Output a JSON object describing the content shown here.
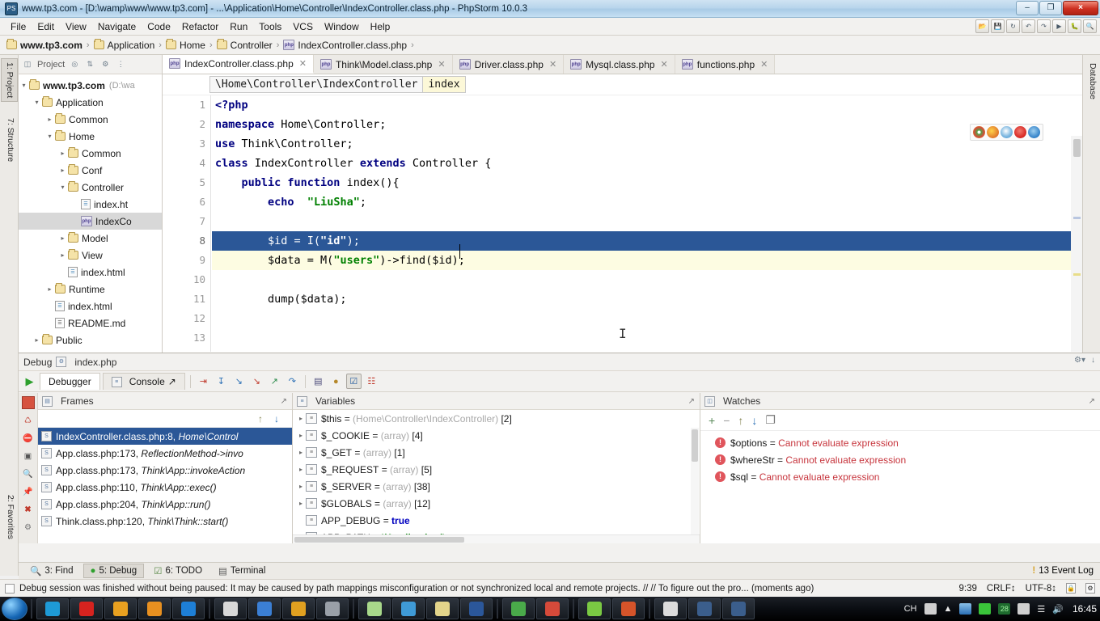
{
  "window": {
    "title": "www.tp3.com - [D:\\wamp\\www\\www.tp3.com] - ...\\Application\\Home\\Controller\\IndexController.class.php - PhpStorm 10.0.3",
    "minimize_label": "–",
    "maximize_label": "❐",
    "close_label": "×"
  },
  "menu": {
    "items": [
      "File",
      "Edit",
      "View",
      "Navigate",
      "Code",
      "Refactor",
      "Run",
      "Tools",
      "VCS",
      "Window",
      "Help"
    ]
  },
  "breadcrumb": {
    "items": [
      {
        "label": "www.tp3.com",
        "icon": "folder-icon"
      },
      {
        "label": "Application",
        "icon": "folder-icon"
      },
      {
        "label": "Home",
        "icon": "folder-icon"
      },
      {
        "label": "Controller",
        "icon": "folder-icon"
      },
      {
        "label": "IndexController.class.php",
        "icon": "php-file-icon"
      }
    ],
    "separator": "›"
  },
  "left_tool_strip": {
    "tabs": [
      {
        "label": "1: Project",
        "active": true
      },
      {
        "label": "7: Structure",
        "active": false
      },
      {
        "label": "2: Favorites",
        "active": false
      }
    ]
  },
  "right_tool_strip": {
    "tabs": [
      {
        "label": "Database"
      }
    ]
  },
  "project_panel": {
    "title": "Project",
    "tree": [
      {
        "label": "www.tp3.com",
        "detail": "(D:\\wa",
        "indent": 0,
        "arrow": "▾",
        "icon": "folder-icon",
        "bold": true,
        "selected": false
      },
      {
        "label": "Application",
        "detail": "",
        "indent": 1,
        "arrow": "▾",
        "icon": "folder-icon",
        "bold": false,
        "selected": false
      },
      {
        "label": "Common",
        "detail": "",
        "indent": 2,
        "arrow": "▸",
        "icon": "folder-icon",
        "bold": false,
        "selected": false
      },
      {
        "label": "Home",
        "detail": "",
        "indent": 2,
        "arrow": "▾",
        "icon": "folder-icon",
        "bold": false,
        "selected": false
      },
      {
        "label": "Common",
        "detail": "",
        "indent": 3,
        "arrow": "▸",
        "icon": "folder-icon",
        "bold": false,
        "selected": false
      },
      {
        "label": "Conf",
        "detail": "",
        "indent": 3,
        "arrow": "▸",
        "icon": "folder-icon",
        "bold": false,
        "selected": false
      },
      {
        "label": "Controller",
        "detail": "",
        "indent": 3,
        "arrow": "▾",
        "icon": "folder-icon",
        "bold": false,
        "selected": false
      },
      {
        "label": "index.ht",
        "detail": "",
        "indent": 4,
        "arrow": "",
        "icon": "html-file-icon",
        "bold": false,
        "selected": false
      },
      {
        "label": "IndexCo",
        "detail": "",
        "indent": 4,
        "arrow": "",
        "icon": "php-file-icon",
        "bold": false,
        "selected": true
      },
      {
        "label": "Model",
        "detail": "",
        "indent": 3,
        "arrow": "▸",
        "icon": "folder-icon",
        "bold": false,
        "selected": false
      },
      {
        "label": "View",
        "detail": "",
        "indent": 3,
        "arrow": "▸",
        "icon": "folder-icon",
        "bold": false,
        "selected": false
      },
      {
        "label": "index.html",
        "detail": "",
        "indent": 3,
        "arrow": "",
        "icon": "html-file-icon",
        "bold": false,
        "selected": false
      },
      {
        "label": "Runtime",
        "detail": "",
        "indent": 2,
        "arrow": "▸",
        "icon": "folder-icon",
        "bold": false,
        "selected": false
      },
      {
        "label": "index.html",
        "detail": "",
        "indent": 2,
        "arrow": "",
        "icon": "html-file-icon",
        "bold": false,
        "selected": false
      },
      {
        "label": "README.md",
        "detail": "",
        "indent": 2,
        "arrow": "",
        "icon": "md-file-icon",
        "bold": false,
        "selected": false
      },
      {
        "label": "Public",
        "detail": "",
        "indent": 1,
        "arrow": "▸",
        "icon": "folder-icon",
        "bold": false,
        "selected": false
      }
    ]
  },
  "editor": {
    "tabs": [
      {
        "label": "IndexController.class.php",
        "active": true
      },
      {
        "label": "Think\\Model.class.php",
        "active": false
      },
      {
        "label": "Driver.class.php",
        "active": false
      },
      {
        "label": "Mysql.class.php",
        "active": false
      },
      {
        "label": "functions.php",
        "active": false
      }
    ],
    "navbar": {
      "class_path": "\\Home\\Controller\\IndexController",
      "method": "index"
    },
    "lines": [
      {
        "n": "1",
        "html": "<span class=\"kw\">&lt;?php</span>",
        "state": "normal",
        "marker": ""
      },
      {
        "n": "2",
        "html": "<span class=\"kw\">namespace</span> Home\\Controller;",
        "state": "normal",
        "marker": ""
      },
      {
        "n": "3",
        "html": "<span class=\"kw\">use</span> Think\\Controller;",
        "state": "normal",
        "marker": ""
      },
      {
        "n": "4",
        "html": "<span class=\"kw\">class</span> IndexController <span class=\"kw\">extends</span> Controller {",
        "state": "normal",
        "marker": ""
      },
      {
        "n": "5",
        "html": "    <span class=\"kw\">public function</span> index(){",
        "state": "normal",
        "marker": ""
      },
      {
        "n": "6",
        "html": "        <span class=\"kw\">echo</span>  <span class=\"str\">\"LiuSha\"</span>;",
        "state": "normal",
        "marker": ""
      },
      {
        "n": "7",
        "html": "",
        "state": "normal",
        "marker": ""
      },
      {
        "n": "8",
        "html": "        $id = I(<span class=\"str\">\"id\"</span>);",
        "state": "selected",
        "marker": "breakpoint"
      },
      {
        "n": "9",
        "html": "        $data = M(<span class=\"str\">\"users\"</span>)-&gt;find($id);",
        "state": "warn",
        "marker": "bulb"
      },
      {
        "n": "10",
        "html": "",
        "state": "normal",
        "marker": ""
      },
      {
        "n": "11",
        "html": "        dump($data);",
        "state": "normal",
        "marker": ""
      },
      {
        "n": "12",
        "html": "",
        "state": "normal",
        "marker": ""
      },
      {
        "n": "13",
        "html": "",
        "state": "normal",
        "marker": ""
      }
    ],
    "browser_icons": [
      {
        "name": "chrome-icon",
        "color": "#4aaa4a"
      },
      {
        "name": "firefox-icon",
        "color": "#e0762a"
      },
      {
        "name": "safari-icon",
        "color": "#3d8fd1"
      },
      {
        "name": "opera-icon",
        "color": "#d6231f"
      },
      {
        "name": "ie-icon",
        "color": "#2f7fc7"
      }
    ]
  },
  "debug": {
    "title": "Debug",
    "subtitle": "index.php",
    "tabs": [
      {
        "label": "Debugger",
        "active": true
      },
      {
        "label": "Console",
        "active": false
      }
    ],
    "toolbar_icons": [
      "step-over-icon",
      "step-into-icon",
      "force-step-into-icon",
      "step-out-icon",
      "run-to-cursor-icon",
      "evaluate-expression-icon",
      "console-icon",
      "mute-breakpoints-icon",
      "view-breakpoints-icon",
      "settings-icon"
    ],
    "sidebar_icons": [
      "stop-icon",
      "rerun-icon",
      "mute-breakpoints-icon",
      "layout-icon",
      "inspect-icon",
      "pin-icon",
      "close-icon",
      "settings-icon"
    ],
    "frames": {
      "title": "Frames",
      "up_label": "↑",
      "down_label": "↓",
      "rows": [
        {
          "file": "IndexController.class.php:8,",
          "fn": "Home\\Control",
          "selected": true
        },
        {
          "file": "App.class.php:173,",
          "fn": "ReflectionMethod->invo",
          "selected": false
        },
        {
          "file": "App.class.php:173,",
          "fn": "Think\\App::invokeAction",
          "selected": false
        },
        {
          "file": "App.class.php:110,",
          "fn": "Think\\App::exec()",
          "selected": false
        },
        {
          "file": "App.class.php:204,",
          "fn": "Think\\App::run()",
          "selected": false
        },
        {
          "file": "Think.class.php:120,",
          "fn": "Think\\Think::start()",
          "selected": false
        }
      ]
    },
    "variables": {
      "title": "Variables",
      "rows": [
        {
          "expandable": true,
          "name": "$this",
          "type": "(Home\\Controller\\IndexController)",
          "count": "[2]",
          "value": "",
          "icon": "object-icon"
        },
        {
          "expandable": true,
          "name": "$_COOKIE",
          "type": "(array)",
          "count": "[4]",
          "value": "",
          "icon": "array-icon"
        },
        {
          "expandable": true,
          "name": "$_GET",
          "type": "(array)",
          "count": "[1]",
          "value": "",
          "icon": "array-icon"
        },
        {
          "expandable": true,
          "name": "$_REQUEST",
          "type": "(array)",
          "count": "[5]",
          "value": "",
          "icon": "array-icon"
        },
        {
          "expandable": true,
          "name": "$_SERVER",
          "type": "(array)",
          "count": "[38]",
          "value": "",
          "icon": "array-icon"
        },
        {
          "expandable": true,
          "name": "$GLOBALS",
          "type": "(array)",
          "count": "[12]",
          "value": "",
          "icon": "array-icon"
        },
        {
          "expandable": false,
          "name": "APP_DEBUG",
          "type": "",
          "count": "",
          "value": "true",
          "icon": "constant-icon"
        },
        {
          "expandable": false,
          "name": "APP_PATH",
          "type": "",
          "count": "",
          "value": "'/Application/'",
          "icon": "constant-icon"
        }
      ]
    },
    "watches": {
      "title": "Watches",
      "toolbar": [
        "add-watch-icon",
        "remove-watch-icon",
        "move-up-icon",
        "move-down-icon",
        "copy-icon"
      ],
      "rows": [
        {
          "name": "$options",
          "value": "Cannot evaluate expression"
        },
        {
          "name": "$whereStr",
          "value": "Cannot evaluate expression"
        },
        {
          "name": "$sql",
          "value": "Cannot evaluate expression"
        }
      ]
    }
  },
  "bottom_tabs": {
    "items": [
      {
        "label": "3: Find",
        "active": false,
        "icon": "find-icon"
      },
      {
        "label": "5: Debug",
        "active": true,
        "icon": "debug-icon"
      },
      {
        "label": "6: TODO",
        "active": false,
        "icon": "todo-icon"
      },
      {
        "label": "Terminal",
        "active": false,
        "icon": "terminal-icon"
      }
    ],
    "event_log": {
      "label": "13 Event Log",
      "badge": "!"
    }
  },
  "status_bar": {
    "message": "Debug session was finished without being paused: It may be caused by path mappings misconfiguration or not synchronized local and remote projects. // // To figure out the pro... (moments ago)",
    "time": "9:39",
    "line_sep": "CRLF↕",
    "encoding": "UTF-8↕"
  },
  "taskbar": {
    "start_label": "start",
    "buttons": [
      {
        "name": "ie-icon",
        "color": "#1e9ad6"
      },
      {
        "name": "opera-icon",
        "color": "#d6231f"
      },
      {
        "name": "search-icon",
        "color": "#e8a020"
      },
      {
        "name": "folder-orange-icon",
        "color": "#e89020"
      },
      {
        "name": "kugou-icon",
        "color": "#1e7fd6"
      },
      {
        "name": "cmd-icon",
        "color": "#d8d8d8"
      },
      {
        "name": "sublime-icon",
        "color": "#3b7fd4"
      },
      {
        "name": "ps-icon",
        "color": "#e0a020"
      },
      {
        "name": "gray-app-icon",
        "color": "#9aa0a8"
      },
      {
        "name": "notepad-icon",
        "color": "#a8d88a"
      },
      {
        "name": "recycle-icon",
        "color": "#3f9ad6"
      },
      {
        "name": "explorer-icon",
        "color": "#e3d48a"
      },
      {
        "name": "word-icon",
        "color": "#2b579a"
      },
      {
        "name": "chrome-icon",
        "color": "#4aaa4a"
      },
      {
        "name": "chrome2-icon",
        "color": "#d64a3a"
      },
      {
        "name": "leaf-icon",
        "color": "#7ac943"
      },
      {
        "name": "excel-icon",
        "color": "#d6542a"
      },
      {
        "name": "phpstorm-icon",
        "color": "#dcdcdc"
      },
      {
        "name": "editor1-icon",
        "color": "#3b5e8c"
      },
      {
        "name": "editor2-icon",
        "color": "#3b5e8c"
      }
    ],
    "tray": {
      "ime": "CH",
      "items": [
        "keyboard-icon",
        "show-hidden-icon",
        "network-icon",
        "battery-icon",
        "calendar-icon",
        "security-icon",
        "signal-icon",
        "volume-icon"
      ],
      "calendar_day": "28",
      "clock": "16:45"
    }
  }
}
